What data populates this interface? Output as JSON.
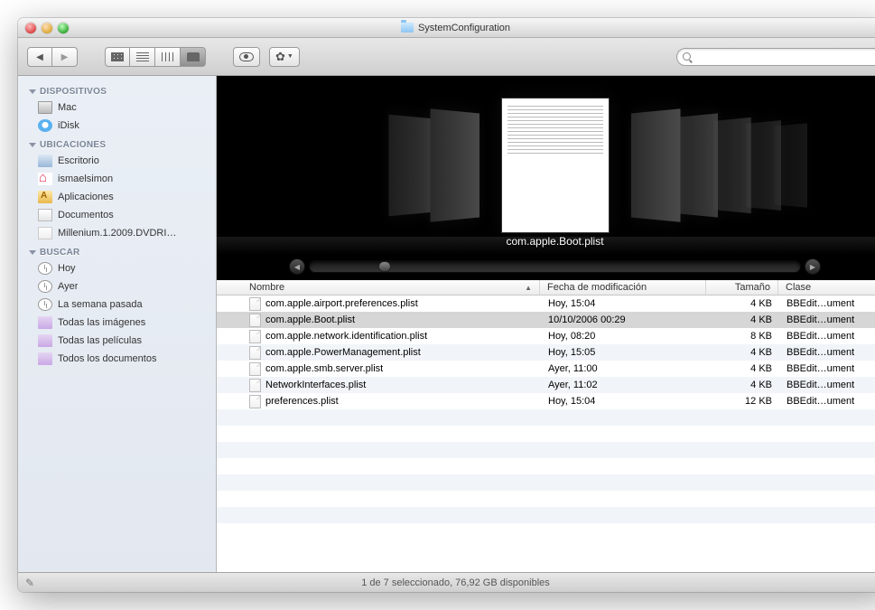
{
  "window": {
    "title": "SystemConfiguration"
  },
  "search": {
    "placeholder": ""
  },
  "sidebar": {
    "sections": [
      {
        "title": "DISPOSITIVOS",
        "items": [
          {
            "label": "Mac",
            "icon": "hd"
          },
          {
            "label": "iDisk",
            "icon": "idisk"
          }
        ]
      },
      {
        "title": "UBICACIONES",
        "items": [
          {
            "label": "Escritorio",
            "icon": "desk"
          },
          {
            "label": "ismaelsimon",
            "icon": "home"
          },
          {
            "label": "Aplicaciones",
            "icon": "apps"
          },
          {
            "label": "Documentos",
            "icon": "docs"
          },
          {
            "label": "Millenium.1.2009.DVDRI…",
            "icon": "file"
          }
        ]
      },
      {
        "title": "BUSCAR",
        "items": [
          {
            "label": "Hoy",
            "icon": "clock"
          },
          {
            "label": "Ayer",
            "icon": "clock"
          },
          {
            "label": "La semana pasada",
            "icon": "clock"
          },
          {
            "label": "Todas las imágenes",
            "icon": "pfold"
          },
          {
            "label": "Todas las películas",
            "icon": "pfold"
          },
          {
            "label": "Todos los documentos",
            "icon": "pfold"
          }
        ]
      }
    ]
  },
  "coverflow": {
    "caption": "com.apple.Boot.plist"
  },
  "columns": {
    "name": "Nombre",
    "modified": "Fecha de modificación",
    "size": "Tamaño",
    "kind": "Clase"
  },
  "files": [
    {
      "name": "com.apple.airport.preferences.plist",
      "modified": "Hoy, 15:04",
      "size": "4 KB",
      "kind": "BBEdit…ument",
      "selected": false
    },
    {
      "name": "com.apple.Boot.plist",
      "modified": "10/10/2006 00:29",
      "size": "4 KB",
      "kind": "BBEdit…ument",
      "selected": true
    },
    {
      "name": "com.apple.network.identification.plist",
      "modified": "Hoy, 08:20",
      "size": "8 KB",
      "kind": "BBEdit…ument",
      "selected": false
    },
    {
      "name": "com.apple.PowerManagement.plist",
      "modified": "Hoy, 15:05",
      "size": "4 KB",
      "kind": "BBEdit…ument",
      "selected": false
    },
    {
      "name": "com.apple.smb.server.plist",
      "modified": "Ayer, 11:00",
      "size": "4 KB",
      "kind": "BBEdit…ument",
      "selected": false
    },
    {
      "name": "NetworkInterfaces.plist",
      "modified": "Ayer, 11:02",
      "size": "4 KB",
      "kind": "BBEdit…ument",
      "selected": false
    },
    {
      "name": "preferences.plist",
      "modified": "Hoy, 15:04",
      "size": "12 KB",
      "kind": "BBEdit…ument",
      "selected": false
    }
  ],
  "status": {
    "text": "1 de 7 seleccionado, 76,92 GB disponibles"
  }
}
